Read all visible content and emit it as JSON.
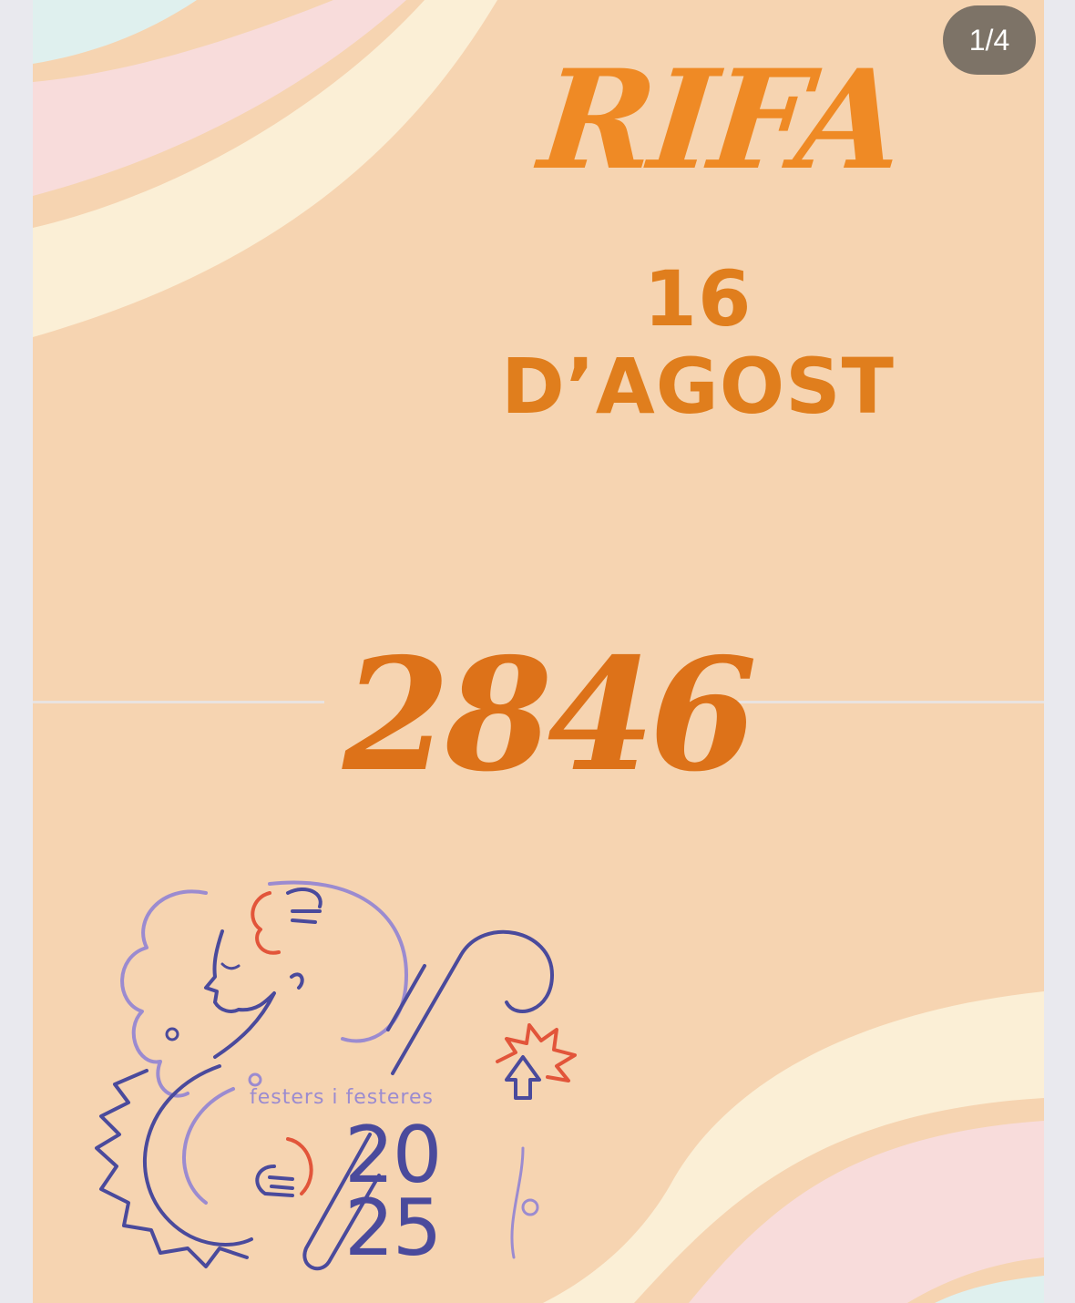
{
  "story": {
    "page_indicator": "1/4",
    "title": "RIFA",
    "date": "16 D’AGOST",
    "ticket_number": "2846"
  },
  "logo": {
    "tagline": "festers i festeres",
    "year_top": "20",
    "year_bottom": "25",
    "icon": "festers-logo-icon"
  },
  "colors": {
    "background": "#f6d4b1",
    "title_orange": "#ef8a25",
    "number_orange": "#dd7219",
    "logo_blue": "#4a4a9c",
    "logo_lilac": "#9b8bd0",
    "logo_red": "#e2553a",
    "wave_pink": "#f8dcdb",
    "wave_cream": "#fbefd6",
    "wave_blue": "#dff0ee"
  }
}
